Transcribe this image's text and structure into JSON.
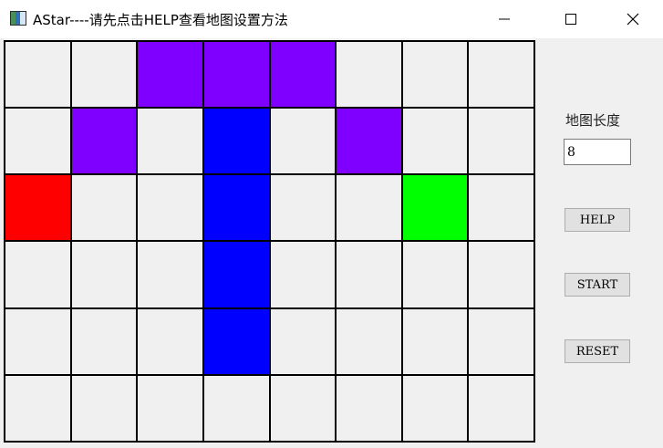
{
  "window": {
    "title": "AStar----请先点击HELP查看地图设置方法",
    "app_icon": "window-app-icon",
    "controls": [
      "minimize-icon",
      "maximize-icon",
      "close-icon"
    ]
  },
  "map": {
    "columns": 8,
    "rows": 6,
    "colors": {
      "empty": "#f0f0f0",
      "obstacle_purple": "#8000ff",
      "path_blue": "#0000ff",
      "start_red": "#ff0000",
      "goal_green": "#00ff00",
      "grid_line": "#000000"
    },
    "cells": [
      [
        "empty",
        "empty",
        "purple",
        "purple",
        "purple",
        "empty",
        "empty",
        "empty"
      ],
      [
        "empty",
        "purple",
        "empty",
        "blue",
        "empty",
        "purple",
        "empty",
        "empty"
      ],
      [
        "red",
        "empty",
        "empty",
        "blue",
        "empty",
        "empty",
        "green",
        "empty"
      ],
      [
        "empty",
        "empty",
        "empty",
        "blue",
        "empty",
        "empty",
        "empty",
        "empty"
      ],
      [
        "empty",
        "empty",
        "empty",
        "blue",
        "empty",
        "empty",
        "empty",
        "empty"
      ],
      [
        "empty",
        "empty",
        "empty",
        "empty",
        "empty",
        "empty",
        "empty",
        "empty"
      ]
    ]
  },
  "sidebar": {
    "length_label": "地图长度",
    "length_value": "8",
    "help_label": "HELP",
    "start_label": "START",
    "reset_label": "RESET"
  }
}
